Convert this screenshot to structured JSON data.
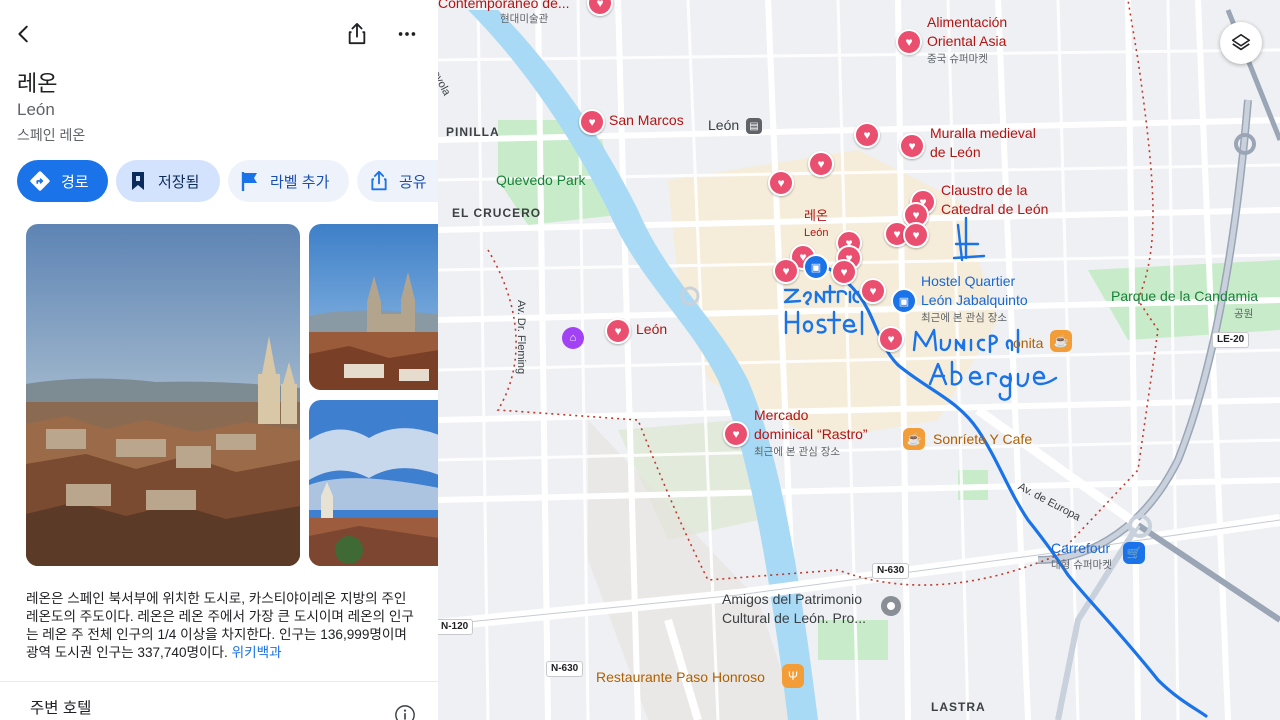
{
  "panel": {
    "title": "레온",
    "subtitle": "León",
    "locality": "스페인 레온",
    "actions": {
      "directions": "경로",
      "saved": "저장됨",
      "add_label": "라벨 추가",
      "share": "공유"
    },
    "description": "레온은 스페인 북서부에 위치한 도시로, 카스티야이레온 지방의 주인 레온도의 주도이다. 레온은 레온 주에서 가장 큰 도시이며 레온의 인구는 레온 주 전체 인구의 1/4 이상을 차지한다. 인구는 136,999명이며 광역 도시권 인구는 337,740명이다.",
    "wiki_link": "위키백과",
    "nearby_section": "주변 호텔"
  },
  "map": {
    "labels": {
      "contemporaneo": "Contemporáneo de...",
      "contemporaneo_ko": "현대미술관",
      "alimentacion_1": "Alimentación",
      "alimentacion_2": "Oriental Asia",
      "alimentacion_ko": "중국 슈퍼마켓",
      "san_marcos": "San Marcos",
      "leon_station": "León",
      "muralla_1": "Muralla medieval",
      "muralla_2": "de León",
      "pinilla": "PINILLA",
      "quevedo": "Quevedo Park",
      "claustro_1": "Claustro de la",
      "claustro_2": "Catedral de León",
      "el_crucero": "EL CRUCERO",
      "leon_ko": "레온",
      "leon_city": "León",
      "hostel_1": "Hostel Quartier",
      "hostel_2": "León Jabalquinto",
      "hostel_sub": "최근에 본 관심 장소",
      "candamia": "Parque de la Candamia",
      "park_sub": "공원",
      "leon_pin": "León",
      "onita": "onita",
      "mercado_1": "Mercado",
      "mercado_2": "dominical “Rastro”",
      "mercado_sub": "최근에 본 관심 장소",
      "sonriete": "Sonríete Y Cafe",
      "av_europa": "Av. de Europa",
      "av_fleming": "Av. Dr. Fleming",
      "loyola": "Loyola",
      "carrefour": "Carrefour",
      "carrefour_sub": "대형 슈퍼마켓",
      "amigos_1": "Amigos del Patrimonio",
      "amigos_2": "Cultural de León. Pro...",
      "restaurante": "Restaurante Paso Honroso",
      "lastra": "LASTRA"
    },
    "roads": {
      "n630_a": "N-630",
      "n630_b": "N-630",
      "n120": "N-120",
      "le20": "LE-20"
    }
  },
  "colors": {
    "accent": "#1a73e8",
    "saved_chip": "#d3e3fd",
    "heart_pin": "#ea4f70",
    "route": "#1a73e8",
    "river": "#a8daf5",
    "park": "#c8ecc9"
  }
}
